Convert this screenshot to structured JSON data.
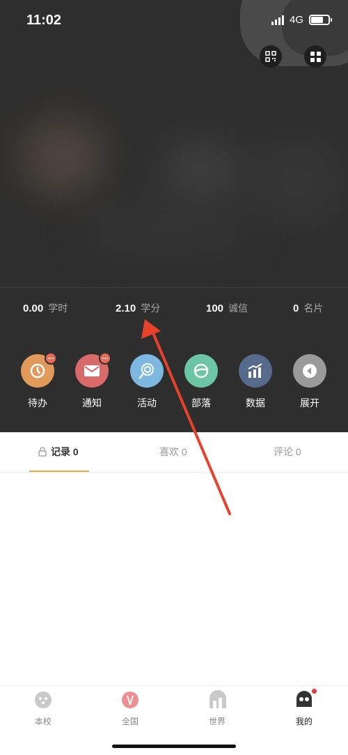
{
  "status_bar": {
    "time": "11:02",
    "network": "4G"
  },
  "header_buttons": {
    "qr_icon": "qr-code-icon",
    "grid_icon": "grid-icon"
  },
  "stats": [
    {
      "value": "0.00",
      "label": "学时"
    },
    {
      "value": "2.10",
      "label": "学分"
    },
    {
      "value": "100",
      "label": "诚信"
    },
    {
      "value": "0",
      "label": "名片"
    }
  ],
  "actions": [
    {
      "label": "待办",
      "color": "#e29a5a",
      "badge": true
    },
    {
      "label": "通知",
      "color": "#d96a6a",
      "badge": true
    },
    {
      "label": "活动",
      "color": "#7db8e0",
      "badge": false
    },
    {
      "label": "部落",
      "color": "#6cc5a5",
      "badge": false
    },
    {
      "label": "数据",
      "color": "#566a8c",
      "badge": false
    },
    {
      "label": "展开",
      "color": "#9a9a9a",
      "badge": false
    }
  ],
  "tabs": [
    {
      "label": "记录 0",
      "active": true
    },
    {
      "label": "喜欢 0",
      "active": false
    },
    {
      "label": "评论 0",
      "active": false
    }
  ],
  "bottom_nav": [
    {
      "label": "本校",
      "icon": "school-icon"
    },
    {
      "label": "全国",
      "icon": "national-icon"
    },
    {
      "label": "世界",
      "icon": "world-icon"
    },
    {
      "label": "我的",
      "icon": "profile-icon",
      "active": true,
      "dot": true
    }
  ],
  "colors": {
    "accent": "#f0a64a",
    "annotation_arrow": "#e8412c"
  }
}
